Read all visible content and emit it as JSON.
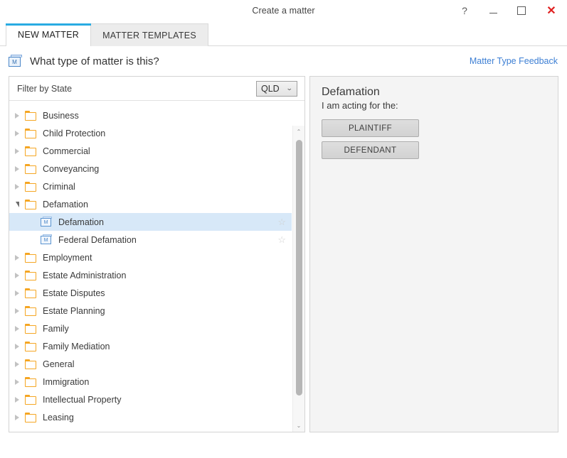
{
  "window": {
    "title": "Create a matter",
    "controls": {
      "help": "?",
      "minimize": "",
      "maximize": "",
      "close": "✕"
    }
  },
  "tabs": [
    {
      "label": "NEW MATTER",
      "active": true
    },
    {
      "label": "MATTER TEMPLATES",
      "active": false
    }
  ],
  "header": {
    "title": "What type of matter is this?",
    "feedback_link": "Matter Type Feedback"
  },
  "filter": {
    "label": "Filter by State",
    "state_value": "QLD",
    "chevron": "⌄"
  },
  "tree": {
    "items": [
      {
        "label": "Business",
        "level": 0,
        "state": "collapsed",
        "icon": "folder-icon",
        "star": false,
        "selected": false
      },
      {
        "label": "Child Protection",
        "level": 0,
        "state": "collapsed",
        "icon": "folder-icon",
        "star": false,
        "selected": false
      },
      {
        "label": "Commercial",
        "level": 0,
        "state": "collapsed",
        "icon": "folder-icon",
        "star": false,
        "selected": false
      },
      {
        "label": "Conveyancing",
        "level": 0,
        "state": "collapsed",
        "icon": "folder-icon",
        "star": false,
        "selected": false
      },
      {
        "label": "Criminal",
        "level": 0,
        "state": "collapsed",
        "icon": "folder-icon",
        "star": false,
        "selected": false
      },
      {
        "label": "Defamation",
        "level": 0,
        "state": "expanded",
        "icon": "folder-icon",
        "star": false,
        "selected": false
      },
      {
        "label": "Defamation",
        "level": 1,
        "state": "leaf",
        "icon": "matter-type-icon",
        "star": true,
        "selected": true
      },
      {
        "label": "Federal Defamation",
        "level": 1,
        "state": "leaf",
        "icon": "matter-type-icon",
        "star": true,
        "selected": false
      },
      {
        "label": "Employment",
        "level": 0,
        "state": "collapsed",
        "icon": "folder-icon",
        "star": false,
        "selected": false
      },
      {
        "label": "Estate Administration",
        "level": 0,
        "state": "collapsed",
        "icon": "folder-icon",
        "star": false,
        "selected": false
      },
      {
        "label": "Estate Disputes",
        "level": 0,
        "state": "collapsed",
        "icon": "folder-icon",
        "star": false,
        "selected": false
      },
      {
        "label": "Estate Planning",
        "level": 0,
        "state": "collapsed",
        "icon": "folder-icon",
        "star": false,
        "selected": false
      },
      {
        "label": "Family",
        "level": 0,
        "state": "collapsed",
        "icon": "folder-icon",
        "star": false,
        "selected": false
      },
      {
        "label": "Family Mediation",
        "level": 0,
        "state": "collapsed",
        "icon": "folder-icon",
        "star": false,
        "selected": false
      },
      {
        "label": "General",
        "level": 0,
        "state": "collapsed",
        "icon": "folder-icon",
        "star": false,
        "selected": false
      },
      {
        "label": "Immigration",
        "level": 0,
        "state": "collapsed",
        "icon": "folder-icon",
        "star": false,
        "selected": false
      },
      {
        "label": "Intellectual Property",
        "level": 0,
        "state": "collapsed",
        "icon": "folder-icon",
        "star": false,
        "selected": false
      },
      {
        "label": "Leasing",
        "level": 0,
        "state": "collapsed",
        "icon": "folder-icon",
        "star": false,
        "selected": false
      }
    ],
    "star_glyph": "☆",
    "scroll_up_glyph": "⌃",
    "scroll_down_glyph": "⌄"
  },
  "detail": {
    "title": "Defamation",
    "subtitle": "I am acting for the:",
    "roles": [
      {
        "label": "PLAINTIFF"
      },
      {
        "label": "DEFENDANT"
      }
    ]
  },
  "colors": {
    "accent": "#29abe2",
    "link": "#3d7fd4",
    "folder": "#f5a623",
    "selection": "#d7e8f8",
    "close": "#e02020"
  },
  "icons": {
    "matter_header": "matter-type-icon",
    "matter_letter": "M"
  }
}
